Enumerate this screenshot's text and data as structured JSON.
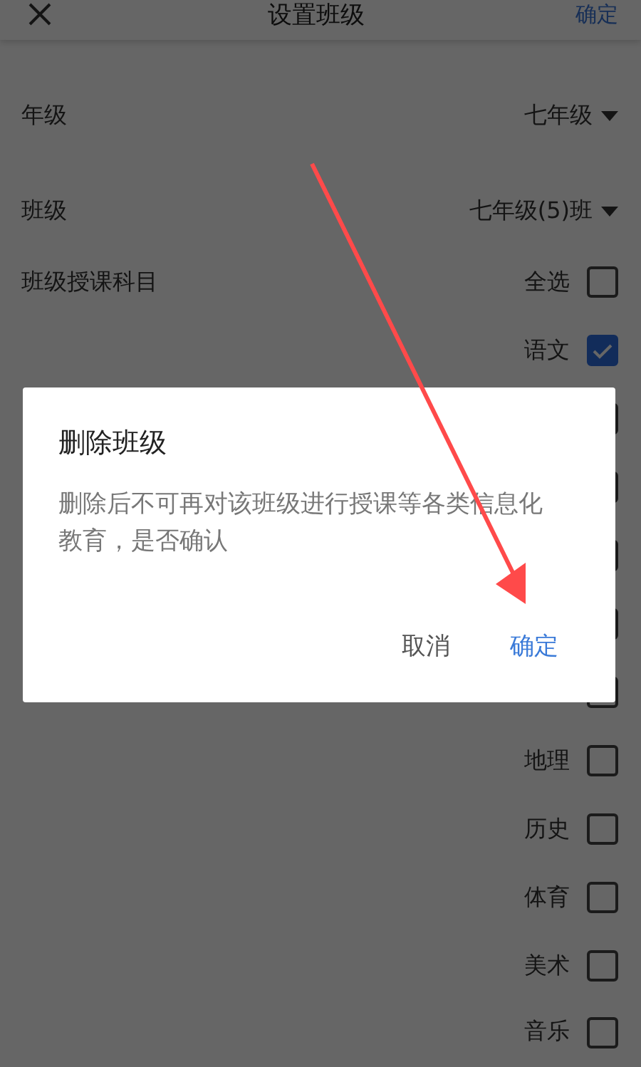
{
  "header": {
    "title": "设置班级",
    "action": "确定"
  },
  "fields": [
    {
      "label": "年级",
      "value": "七年级"
    },
    {
      "label": "班级",
      "value": "七年级(5)班"
    }
  ],
  "subjects": {
    "label": "班级授课科目",
    "options": [
      {
        "label": "全选",
        "checked": false
      },
      {
        "label": "语文",
        "checked": true
      },
      {
        "checked": false
      },
      {
        "checked": false
      },
      {
        "checked": false
      },
      {
        "checked": false
      },
      {
        "checked": false
      },
      {
        "label": "地理",
        "checked": false
      },
      {
        "label": "历史",
        "checked": false
      },
      {
        "label": "体育",
        "checked": false
      },
      {
        "label": "美术",
        "checked": false
      },
      {
        "label": "音乐",
        "checked": false
      }
    ]
  },
  "dialog": {
    "title": "删除班级",
    "message": "删除后不可再对该班级进行授课等各类信息化教育，是否确认",
    "buttons": [
      {
        "label": "取消",
        "kind": "cancel"
      },
      {
        "label": "确定",
        "kind": "confirm"
      }
    ]
  },
  "annotation": {
    "kind": "arrow"
  }
}
